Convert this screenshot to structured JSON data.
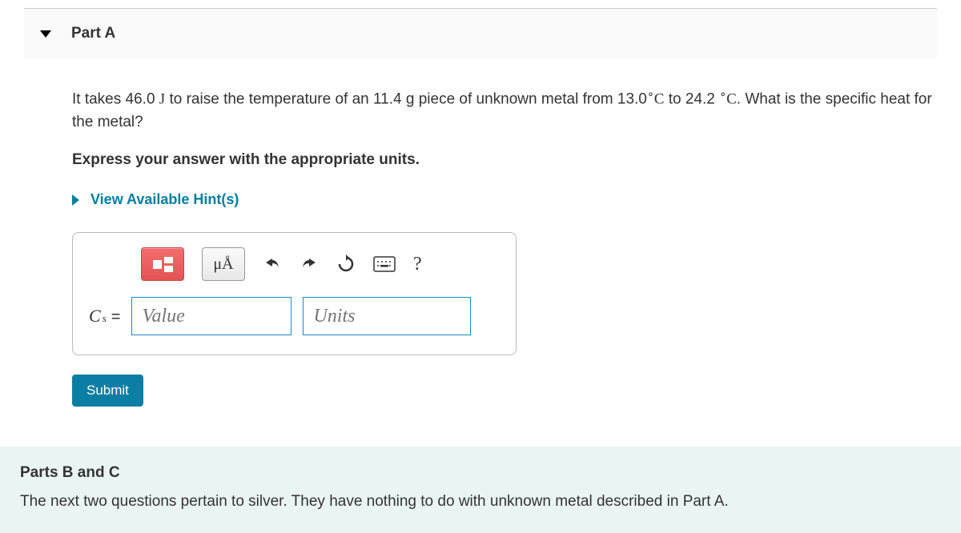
{
  "partA": {
    "label": "Part A",
    "questionPrefix": "It takes 46.0 ",
    "jSymbol": "J",
    "questionMid": " to raise the temperature of an 11.4 g piece of unknown metal from 13.0",
    "deg1": "∘",
    "c1": "C",
    "to": " to 24.2 ",
    "deg2": "∘",
    "c2": "C",
    "questionEnd": ". What is the specific heat for the metal?",
    "instruction": "Express your answer with the appropriate units.",
    "hintLabel": "View Available Hint(s)",
    "toolbar": {
      "unitsBtn": "μÅ",
      "help": "?"
    },
    "varSymbol": "C",
    "varSub": "s",
    "equals": "=",
    "valuePlaceholder": "Value",
    "unitsPlaceholder": "Units",
    "submitLabel": "Submit"
  },
  "partsBC": {
    "title": "Parts B and C",
    "text": "The next two questions pertain to silver. They have nothing to do with unknown metal described in Part A."
  }
}
